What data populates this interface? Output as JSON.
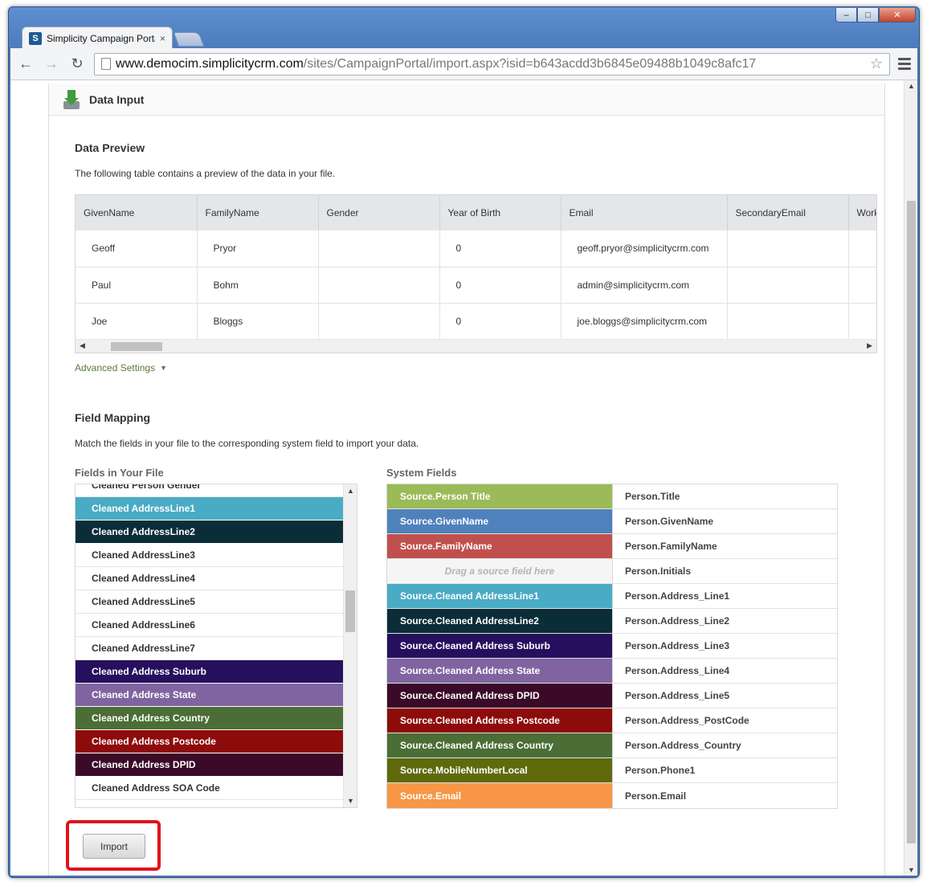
{
  "browser": {
    "tab_title": "Simplicity Campaign Portal",
    "favicon_letter": "S",
    "tab_close": "×",
    "url_host": "www.democim.simplicitycrm.com",
    "url_path": "/sites/CampaignPortal/import.aspx?isid=b643acdd3b6845e09488b1049c8afc17",
    "icons": [
      "back-icon",
      "forward-icon",
      "reload-icon",
      "star-icon",
      "menu-icon"
    ]
  },
  "panel": {
    "title": "Data Input",
    "icon": "data-input-icon"
  },
  "preview": {
    "title": "Data Preview",
    "description": "The following table contains a preview of the data in your file.",
    "columns": [
      "GivenName",
      "FamilyName",
      "Gender",
      "Year of Birth",
      "Email",
      "SecondaryEmail",
      "Work"
    ],
    "rows": [
      [
        "Geoff",
        "Pryor",
        "",
        "0",
        "geoff.pryor@simplicitycrm.com",
        "",
        ""
      ],
      [
        "Paul",
        "Bohm",
        "",
        "0",
        "admin@simplicitycrm.com",
        "",
        ""
      ],
      [
        "Joe",
        "Bloggs",
        "",
        "0",
        "joe.bloggs@simplicitycrm.com",
        "",
        ""
      ]
    ]
  },
  "advanced_settings": "Advanced Settings",
  "mapping": {
    "title": "Field Mapping",
    "description": "Match the fields in your file to the corresponding system field to import your data.",
    "file_fields_label": "Fields in Your File",
    "system_fields_label": "System Fields",
    "file_fields": [
      {
        "label": "Cleaned Person Gender",
        "color": ""
      },
      {
        "label": "Cleaned AddressLine1",
        "color": "#4aabc5"
      },
      {
        "label": "Cleaned AddressLine2",
        "color": "#0b2d38"
      },
      {
        "label": "Cleaned AddressLine3",
        "color": ""
      },
      {
        "label": "Cleaned AddressLine4",
        "color": ""
      },
      {
        "label": "Cleaned AddressLine5",
        "color": ""
      },
      {
        "label": "Cleaned AddressLine6",
        "color": ""
      },
      {
        "label": "Cleaned AddressLine7",
        "color": ""
      },
      {
        "label": "Cleaned Address Suburb",
        "color": "#26105e"
      },
      {
        "label": "Cleaned Address State",
        "color": "#8064a2"
      },
      {
        "label": "Cleaned Address Country",
        "color": "#4a6e35"
      },
      {
        "label": "Cleaned Address Postcode",
        "color": "#8e0b0b"
      },
      {
        "label": "Cleaned Address DPID",
        "color": "#3b0a28"
      },
      {
        "label": "Cleaned Address SOA Code",
        "color": ""
      }
    ],
    "system_fields": [
      {
        "source": "Source.Person Title",
        "target": "Person.Title",
        "color": "#9bbb59"
      },
      {
        "source": "Source.GivenName",
        "target": "Person.GivenName",
        "color": "#4f81bd"
      },
      {
        "source": "Source.FamilyName",
        "target": "Person.FamilyName",
        "color": "#c0504d"
      },
      {
        "source": "Drag a source field here",
        "target": "Person.Initials",
        "color": ""
      },
      {
        "source": "Source.Cleaned AddressLine1",
        "target": "Person.Address_Line1",
        "color": "#4aabc5"
      },
      {
        "source": "Source.Cleaned AddressLine2",
        "target": "Person.Address_Line2",
        "color": "#0b2d38"
      },
      {
        "source": "Source.Cleaned Address Suburb",
        "target": "Person.Address_Line3",
        "color": "#26105e"
      },
      {
        "source": "Source.Cleaned Address State",
        "target": "Person.Address_Line4",
        "color": "#8064a2"
      },
      {
        "source": "Source.Cleaned Address DPID",
        "target": "Person.Address_Line5",
        "color": "#3b0a28"
      },
      {
        "source": "Source.Cleaned Address Postcode",
        "target": "Person.Address_PostCode",
        "color": "#8e0b0b"
      },
      {
        "source": "Source.Cleaned Address Country",
        "target": "Person.Address_Country",
        "color": "#4a6e35"
      },
      {
        "source": "Source.MobileNumberLocal",
        "target": "Person.Phone1",
        "color": "#5f6a0c"
      },
      {
        "source": "Source.Email",
        "target": "Person.Email",
        "color": "#f79646"
      }
    ]
  },
  "import_button": "Import",
  "colors": {
    "highlight": "#e0141c",
    "link_green": "#5a7a3a"
  }
}
